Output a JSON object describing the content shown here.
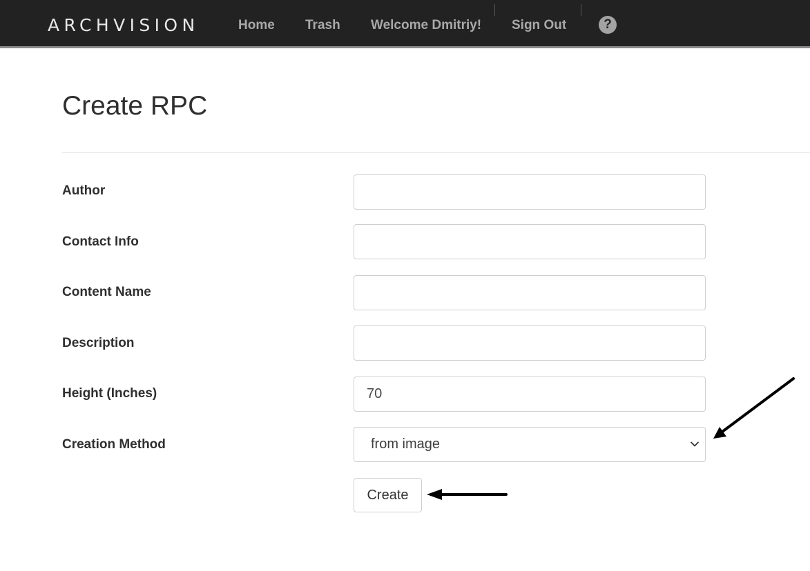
{
  "navbar": {
    "brand": "ARCHVISION",
    "links": {
      "home": "Home",
      "trash": "Trash",
      "welcome": "Welcome Dmitriy!",
      "signout": "Sign Out"
    },
    "help_glyph": "?",
    "help_icon": "question-circle-icon",
    "background_color": "#222222"
  },
  "page": {
    "title": "Create RPC"
  },
  "form": {
    "author": {
      "label": "Author",
      "value": ""
    },
    "contact_info": {
      "label": "Contact Info",
      "value": ""
    },
    "content_name": {
      "label": "Content Name",
      "value": ""
    },
    "description": {
      "label": "Description",
      "value": ""
    },
    "height": {
      "label": "Height (Inches)",
      "value": "70"
    },
    "creation_method": {
      "label": "Creation Method",
      "selected": "from image",
      "icon": "chevron-down-icon"
    },
    "create_button_label": "Create"
  },
  "annotations": {
    "arrow_color": "#000000",
    "arrows": [
      "arrow-to-creation-method-select",
      "arrow-to-create-button"
    ]
  }
}
